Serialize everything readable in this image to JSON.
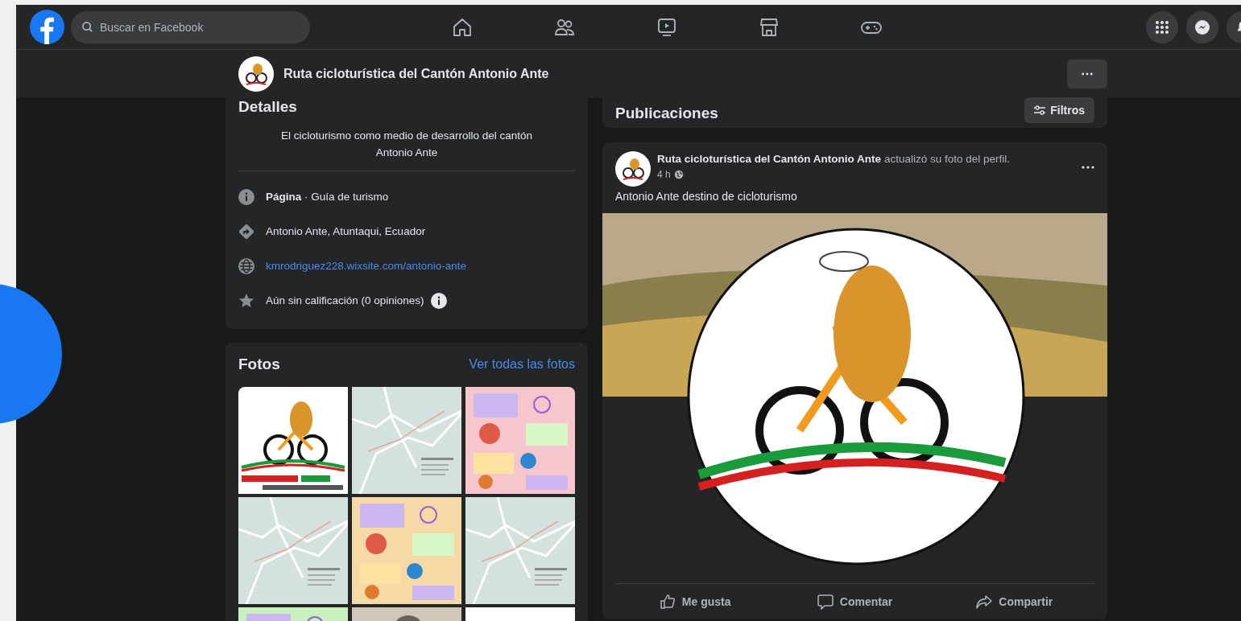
{
  "topbar": {
    "search": {
      "placeholder": "Buscar en Facebook"
    },
    "nav": [
      {
        "kind": "home"
      },
      {
        "kind": "friends"
      },
      {
        "kind": "video"
      },
      {
        "kind": "store"
      },
      {
        "kind": "games"
      }
    ],
    "shortcuts": [
      {
        "kind": "menu"
      },
      {
        "kind": "messenger"
      },
      {
        "kind": "notifications"
      }
    ]
  },
  "page_header": {
    "title": "Ruta cicloturística del Cantón Antonio Ante"
  },
  "details": {
    "title": "Detalles",
    "description": "El cicloturismo como medio de desarrollo del cantón Antonio Ante",
    "items": [
      {
        "kind": "category",
        "text": "**Página** · Guía de turismo"
      },
      {
        "kind": "address",
        "text": "Antonio Ante, Atuntaqui, Ecuador"
      },
      {
        "kind": "website",
        "text": "kmrodriguez228.wixsite.com/antonio-ante"
      },
      {
        "kind": "rating",
        "text": "Aún sin calificación (0 opiniones)"
      }
    ]
  },
  "photos": {
    "title": "Fotos",
    "link": "Ver todas las fotos",
    "tiles": [
      {
        "kind": "logo"
      },
      {
        "kind": "map"
      },
      {
        "kind": "poster",
        "color": "#f7c6cc"
      },
      {
        "kind": "map"
      },
      {
        "kind": "poster",
        "color": "#f5d9a6"
      },
      {
        "kind": "map"
      },
      {
        "kind": "poster",
        "color": "#c9f0bf"
      },
      {
        "kind": "photo"
      },
      {
        "kind": "logo"
      }
    ]
  },
  "posts": {
    "title": "Publicaciones",
    "filter_button": "Filtros",
    "post": {
      "author": "Ruta cicloturística del Cantón Antonio Ante",
      "action": "actualizó su foto del perfil.",
      "time": "4 h",
      "text": "Antonio Ante destino de cicloturismo",
      "actions": [
        {
          "kind": "like",
          "label": "Me gusta"
        },
        {
          "kind": "comment",
          "label": "Comentar"
        },
        {
          "kind": "share",
          "label": "Compartir"
        }
      ]
    }
  }
}
